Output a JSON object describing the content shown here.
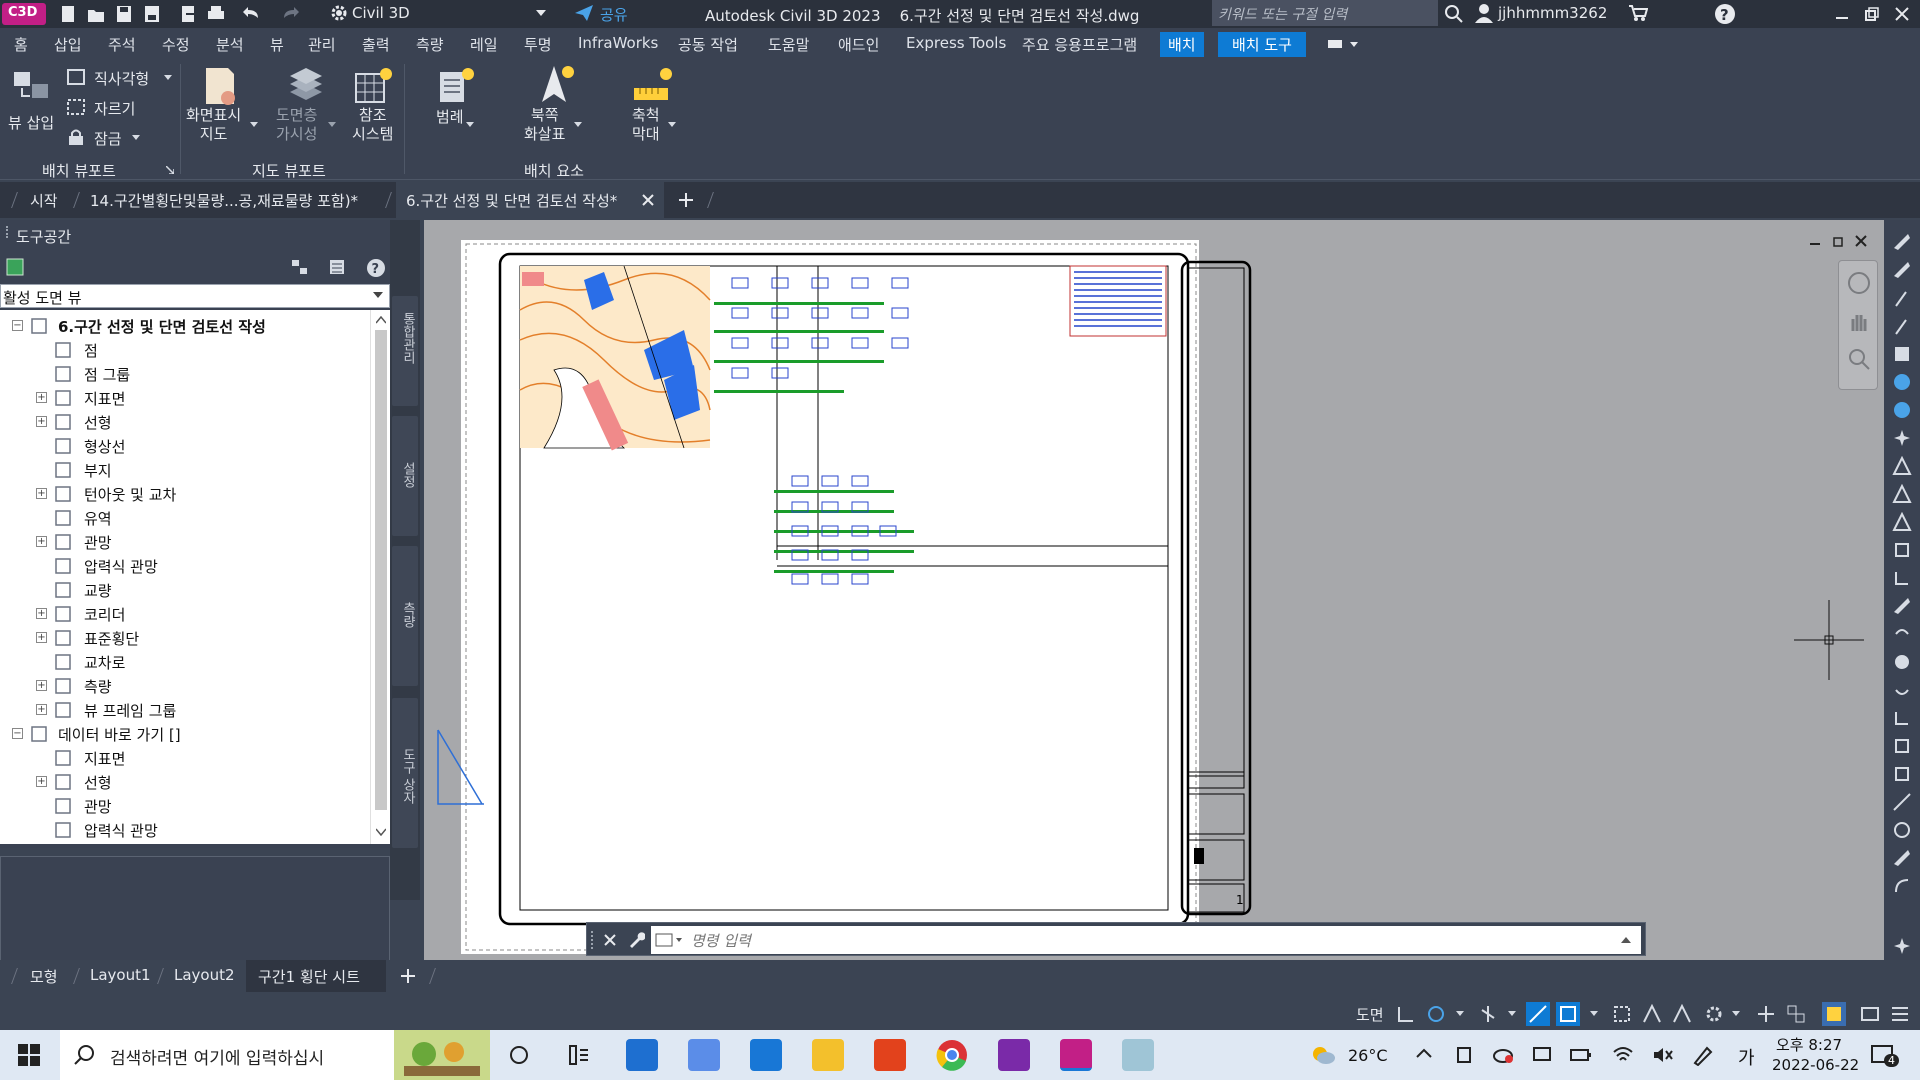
{
  "titlebar": {
    "app_badge": "C3D",
    "workspace": "Civil 3D",
    "share": "공유",
    "title": "Autodesk Civil 3D 2023    6.구간 선정 및 단면 검토선 작성.dwg",
    "search_placeholder": "키워드 또는 구절 입력",
    "user": "jjhhmmm3262"
  },
  "menu": {
    "items": [
      "홈",
      "삽입",
      "주석",
      "수정",
      "분석",
      "뷰",
      "관리",
      "출력",
      "측량",
      "레일",
      "투명",
      "InfraWorks",
      "공동 작업",
      "도움말",
      "애드인",
      "Express Tools",
      "주요 응용프로그램",
      "배치",
      "배치 도구"
    ],
    "active": "배치 도구"
  },
  "ribbon": {
    "view_insert": "뷰 삽입",
    "rectangular": "직사각형",
    "clip": "자르기",
    "lock": "잠금",
    "screen_map": "화면표시\n지도",
    "drawing_visibility": "도면층\n가시성",
    "reference_system": "참조\n시스템",
    "legend": "범례",
    "north_arrow": "북쪽\n화살표",
    "scale_bar": "축척\n막대",
    "group_layout_viewport": "배치 뷰포트",
    "group_map_viewport": "지도 뷰포트",
    "group_layout_elements": "배치 요소"
  },
  "doctabs": {
    "start": "시작",
    "tab1": "14.구간별횡단및물량...공,재료물량 포함)*",
    "tab2": "6.구간 선정 및 단면 검토선 작성*"
  },
  "toolspace": {
    "title": "도구공간",
    "view_select": "활성 도면 뷰",
    "tree": [
      {
        "label": "6.구간 선정 및 단면 검토선 작성",
        "level": 0,
        "expander": "−",
        "bold": true,
        "icon": "drawing-icon"
      },
      {
        "label": "점",
        "level": 1,
        "expander": "",
        "icon": "point-icon"
      },
      {
        "label": "점 그룹",
        "level": 1,
        "expander": "",
        "icon": "point-group-icon"
      },
      {
        "label": "지표면",
        "level": 1,
        "expander": "+",
        "icon": "surface-icon"
      },
      {
        "label": "선형",
        "level": 1,
        "expander": "+",
        "icon": "alignment-icon"
      },
      {
        "label": "형상선",
        "level": 1,
        "expander": "",
        "icon": "feature-line-icon"
      },
      {
        "label": "부지",
        "level": 1,
        "expander": "",
        "icon": "site-icon"
      },
      {
        "label": "턴아웃 및 교차",
        "level": 1,
        "expander": "+",
        "icon": "turnout-icon"
      },
      {
        "label": "유역",
        "level": 1,
        "expander": "",
        "icon": "catchment-icon"
      },
      {
        "label": "관망",
        "level": 1,
        "expander": "+",
        "icon": "pipe-network-icon"
      },
      {
        "label": "압력식 관망",
        "level": 1,
        "expander": "",
        "icon": "pressure-network-icon"
      },
      {
        "label": "교량",
        "level": 1,
        "expander": "",
        "icon": "bridge-icon"
      },
      {
        "label": "코리더",
        "level": 1,
        "expander": "+",
        "icon": "corridor-icon"
      },
      {
        "label": "표준횡단",
        "level": 1,
        "expander": "+",
        "icon": "assembly-icon"
      },
      {
        "label": "교차로",
        "level": 1,
        "expander": "",
        "icon": "intersection-icon"
      },
      {
        "label": "측량",
        "level": 1,
        "expander": "+",
        "icon": "survey-icon"
      },
      {
        "label": "뷰 프레임 그룹",
        "level": 1,
        "expander": "+",
        "icon": "view-frame-icon"
      },
      {
        "label": "데이터 바로 가기 []",
        "level": 0,
        "expander": "−",
        "bold": false,
        "icon": "data-shortcut-icon"
      },
      {
        "label": "지표면",
        "level": 1,
        "expander": "",
        "icon": "surface-icon"
      },
      {
        "label": "선형",
        "level": 1,
        "expander": "+",
        "icon": "alignment-icon"
      },
      {
        "label": "관망",
        "level": 1,
        "expander": "",
        "icon": "pipe-network-icon"
      },
      {
        "label": "압력식 관망",
        "level": 1,
        "expander": "",
        "icon": "pressure-network-icon"
      }
    ],
    "side_tabs": [
      "통합관리",
      "설정",
      "측량",
      "도구 상자"
    ]
  },
  "command": {
    "placeholder": "명령 입력"
  },
  "layout_tabs": {
    "items": [
      "모형",
      "Layout1",
      "Layout2",
      "구간1 횡단 시트"
    ],
    "active": "구간1 횡단 시트"
  },
  "statusbar": {
    "space": "도면"
  },
  "taskbar": {
    "search_placeholder": "검색하려면 여기에 입력하십시",
    "weather": "26°C",
    "ime": "가",
    "time": "오후 8:27",
    "date": "2022-06-22",
    "notif_count": "4"
  },
  "titleblock_page": "1"
}
